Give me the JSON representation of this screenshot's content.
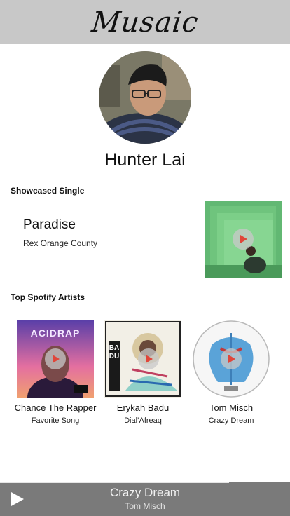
{
  "app": {
    "title": "Musaic"
  },
  "profile": {
    "name": "Hunter Lai"
  },
  "showcased": {
    "section_title": "Showcased Single",
    "song": "Paradise",
    "artist": "Rex Orange County"
  },
  "top_artists": {
    "section_title": "Top Spotify Artists",
    "items": [
      {
        "name": "Chance The Rapper",
        "song": "Favorite Song",
        "cover_text": "ACIDRAP"
      },
      {
        "name": "Erykah Badu",
        "song": "Dial’Afreaq",
        "cover_text": "BADU"
      },
      {
        "name": "Tom Misch",
        "song": "Crazy Dream",
        "cover_text": ""
      }
    ]
  },
  "now_playing": {
    "title": "Crazy Dream",
    "artist": "Tom Misch",
    "progress": 0.79
  },
  "colors": {
    "header_bg": "#c8c8c8",
    "player_bg": "#7a7a7a",
    "play_icon": "#e0463a"
  },
  "icons": {
    "play": "play-icon",
    "player_play": "player-play-icon"
  }
}
